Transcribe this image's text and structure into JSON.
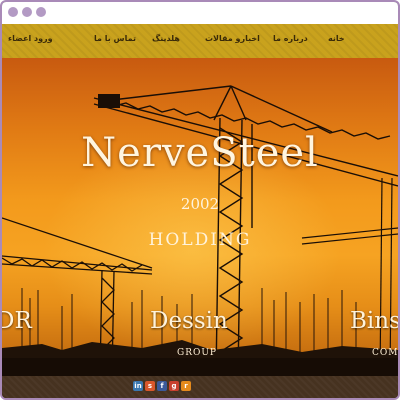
{
  "window": {
    "controls": [
      "close-dot",
      "minimize-dot",
      "zoom-dot"
    ]
  },
  "nav": {
    "items": [
      {
        "label": "خانه",
        "name": "nav-item-home"
      },
      {
        "label": "درباره ما",
        "name": "nav-item-about"
      },
      {
        "label": "اخبارو مقالات",
        "name": "nav-item-news"
      },
      {
        "label": "هلدینگ",
        "name": "nav-item-holding"
      },
      {
        "label": "تماس با ما",
        "name": "nav-item-contact"
      },
      {
        "label": "ورود اعضاء",
        "name": "nav-item-login"
      }
    ]
  },
  "hero": {
    "brand": "NerveSteel",
    "year": "2002",
    "subtitle": "HOLDING",
    "companies": [
      {
        "name": "DR",
        "sub": ""
      },
      {
        "name": "Dessin",
        "sub": "GROUP"
      },
      {
        "name": "Bins",
        "sub": "COMI"
      }
    ]
  },
  "footer": {
    "social_icons": [
      "linkedin-icon",
      "stumbleupon-icon",
      "facebook-icon",
      "google-plus-icon",
      "rss-icon"
    ]
  },
  "colors": {
    "navbar": "#c9a21d",
    "footer": "#463220",
    "hero_sky": "#f39a1c",
    "frame": "#a98ab8"
  }
}
